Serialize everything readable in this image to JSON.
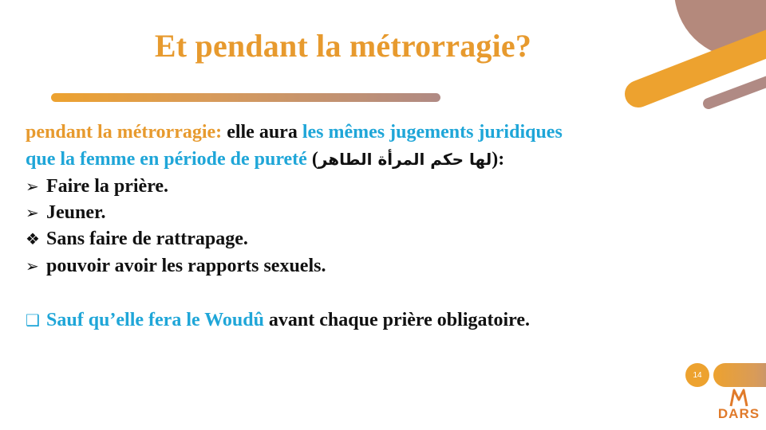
{
  "slide": {
    "title": "Et pendant la métrorragie?",
    "page_number": "14",
    "logo_text": "DARS"
  },
  "content": {
    "line1": {
      "lead": "pendant la métrorragie:",
      "mid": " elle aura ",
      "highlight": "les mêmes jugements juridiques"
    },
    "line2": {
      "highlight": "que la femme en période de pureté",
      "open": " (",
      "arabic": "لها حكم المرأة الطاهر",
      "close": "):"
    },
    "bullets": [
      {
        "symbol": "➢",
        "text": "Faire la prière."
      },
      {
        "symbol": "➢",
        "text": "Jeuner."
      },
      {
        "symbol": "❖",
        "text": "Sans faire de rattrapage."
      },
      {
        "symbol": "➢",
        "text": "pouvoir avoir les rapports sexuels."
      }
    ],
    "note": {
      "symbol": "❑",
      "highlight": "Sauf qu’elle fera le Woudû",
      "rest": " avant chaque prière obligatoire."
    }
  },
  "colors": {
    "accent_orange": "#E79A2E",
    "accent_blue": "#1FA6D8",
    "accent_mauve": "#B08A84"
  }
}
